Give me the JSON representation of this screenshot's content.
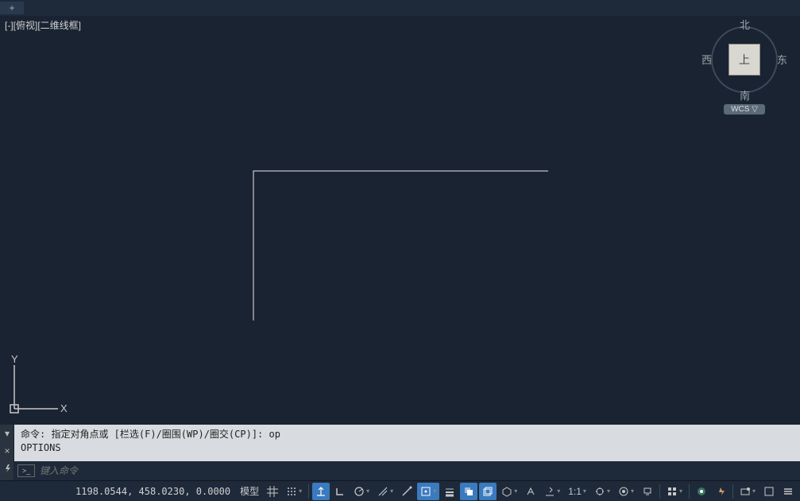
{
  "tabbar": {
    "add": "+"
  },
  "viewport_label": "[-][俯视][二维线框]",
  "viewcube": {
    "n": "北",
    "s": "南",
    "e": "东",
    "w": "西",
    "face": "上",
    "wcs": "WCS ▽"
  },
  "cmd": {
    "history1": "命令: 指定对角点或 [栏选(F)/圈围(WP)/圈交(CP)]: op",
    "history2": "OPTIONS",
    "prompt_icon": ">_",
    "placeholder": "键入命令"
  },
  "status": {
    "coords": "1198.0544, 458.0230, 0.0000",
    "model": "模型",
    "scale": "1:1"
  }
}
